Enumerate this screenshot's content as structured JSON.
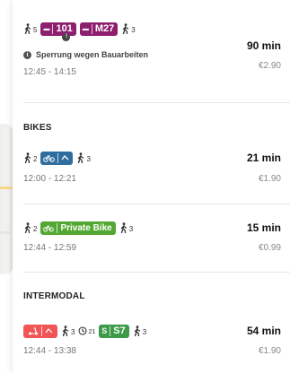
{
  "routes": [
    {
      "legs_walk": [
        "5",
        "3"
      ],
      "badges": [
        {
          "mode": "BUS",
          "line": "101"
        },
        {
          "mode": "BUS",
          "line": "M27"
        }
      ],
      "notice": "Sperrung wegen Bauarbeiten",
      "time": "12:45 - 14:15",
      "duration": "90 min",
      "price": "€2.90"
    }
  ],
  "sections": {
    "bikes": {
      "title": "BIKES",
      "routes": [
        {
          "walk_before": "2",
          "walk_after": "3",
          "time": "12:00 - 12:21",
          "duration": "21 min",
          "price": "€1.90"
        },
        {
          "walk_before": "2",
          "badge_label": "Private Bike",
          "walk_after": "3",
          "time": "12:44 - 12:59",
          "duration": "15 min",
          "price": "€0.99"
        }
      ]
    },
    "intermodal": {
      "title": "INTERMODAL",
      "routes": [
        {
          "walk_1": "3",
          "wait": "21",
          "sbahn_mode": "S",
          "sbahn_line": "S7",
          "walk_2": "3",
          "time": "12:44 - 13:38",
          "duration": "54 min",
          "price": "€1.90"
        }
      ]
    }
  },
  "colors": {
    "bus": "#8e1e6e",
    "bike_share": "#2f6d9e",
    "private_bike": "#52a832",
    "sbahn": "#3c9a48",
    "scooter": "#f15555"
  }
}
